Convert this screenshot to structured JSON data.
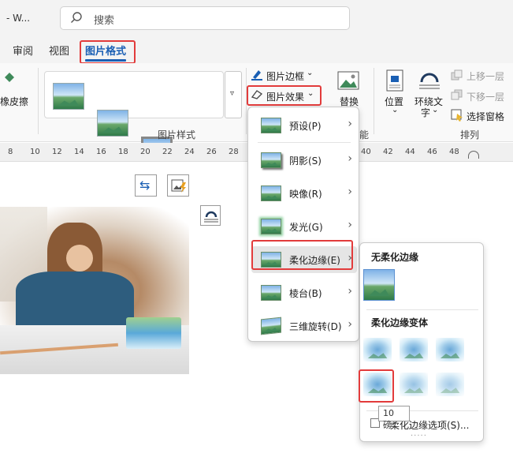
{
  "window": {
    "title": "- W..."
  },
  "search": {
    "placeholder": "搜索"
  },
  "tabs": [
    {
      "label": "审阅"
    },
    {
      "label": "视图"
    },
    {
      "label": "图片格式",
      "active": true
    }
  ],
  "ribbon": {
    "remove_bg": "橡皮擦",
    "styles_group_label": "图片样式",
    "border_label": "图片边框",
    "effects_label": "图片效果",
    "alt_text_label": "替换",
    "access_group_partial": "能",
    "position_label": "位置",
    "wrap_label_1": "环绕文",
    "wrap_label_2": "字",
    "bring_forward": "上移一层",
    "send_backward": "下移一层",
    "selection_pane": "选择窗格",
    "arrange_group_label": "排列"
  },
  "ruler": {
    "ticks": [
      "8",
      "10",
      "12",
      "14",
      "16",
      "18",
      "20",
      "22",
      "24",
      "26",
      "28",
      "40",
      "42",
      "44",
      "46",
      "48"
    ]
  },
  "effects_menu": {
    "items": [
      {
        "label": "预设(P)"
      },
      {
        "label": "阴影(S)"
      },
      {
        "label": "映像(R)"
      },
      {
        "label": "发光(G)"
      },
      {
        "label": "柔化边缘(E)",
        "selected": true
      },
      {
        "label": "棱台(B)"
      },
      {
        "label": "三维旋转(D)"
      }
    ]
  },
  "soft_edges_submenu": {
    "no_soft_heading": "无柔化边缘",
    "variations_heading": "柔化边缘变体",
    "options_label": "柔化边缘选项(S)...",
    "tooltip": "10 磅",
    "more_dots": "....."
  },
  "colors": {
    "accent": "#1a5fb4",
    "highlight": "#e23b3b"
  }
}
